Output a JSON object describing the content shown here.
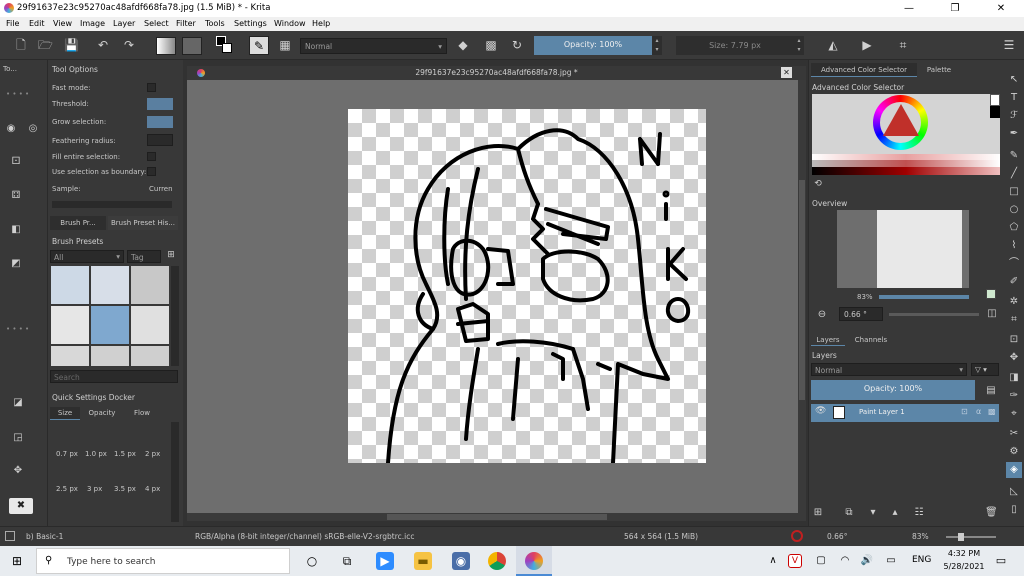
{
  "window": {
    "title": "29f91637e23c95270ac48afdf668fa78.jpg (1.5 MiB)  * - Krita",
    "min": "—",
    "max": "❐",
    "close": "✕"
  },
  "menu": [
    "File",
    "Edit",
    "View",
    "Image",
    "Layer",
    "Select",
    "Filter",
    "Tools",
    "Settings",
    "Window",
    "Help"
  ],
  "toolbar": {
    "blend_mode": "Normal",
    "opacity": "Opacity: 100%",
    "size": "Size: 7.79 px"
  },
  "tool_options": {
    "title": "Tool Options",
    "short_title": "To...",
    "fast_mode": "Fast mode:",
    "threshold": "Threshold:",
    "grow_selection": "Grow selection:",
    "feathering_radius": "Feathering radius:",
    "fill_entire_selection": "Fill entire selection:",
    "use_selection_boundary": "Use selection as boundary:",
    "sample": "Sample:",
    "sample_value": "Curren"
  },
  "brush_tabs": [
    "Brush Pr...",
    "Brush Preset His..."
  ],
  "brush_presets": {
    "title": "Brush Presets",
    "filter": "All",
    "tag": "Tag",
    "search_placeholder": "Search"
  },
  "quick_settings": {
    "title": "Quick Settings Docker",
    "tabs": [
      "Size",
      "Opacity",
      "Flow"
    ],
    "sizes_row1": [
      "0.7 px",
      "1.0 px",
      "1.5 px",
      "2 px"
    ],
    "sizes_row2": [
      "2.5 px",
      "3 px",
      "3.5 px",
      "4 px"
    ]
  },
  "document": {
    "tab_title": "29f91637e23c95270ac48afdf668fa78.jpg *",
    "close": "✕"
  },
  "right": {
    "tabs": [
      "Advanced Color Selector",
      "Palette"
    ],
    "acs_title": "Advanced Color Selector",
    "overview_title": "Overview",
    "zoom": "83%",
    "rotation": "0.66 °",
    "layer_tabs": [
      "Layers",
      "Channels"
    ],
    "layers_title": "Layers",
    "layer_mode": "Normal",
    "layer_opacity": "Opacity:  100%",
    "layer_name": "Paint Layer 1"
  },
  "status": {
    "brush": "b) Basic-1",
    "color_space": "RGB/Alpha (8-bit integer/channel)  sRGB-elle-V2-srgbtrc.icc",
    "dimensions": "564 x 564 (1.5 MiB)",
    "rotation": "0.66°",
    "zoom": "83%"
  },
  "taskbar": {
    "search_placeholder": "Type here to search",
    "lang": "ENG",
    "time": "4:32 PM",
    "date": "5/28/2021"
  },
  "colors": {
    "accent": "#5c86a8",
    "panel": "#383838",
    "canvas_bg": "#6e6e6e"
  }
}
